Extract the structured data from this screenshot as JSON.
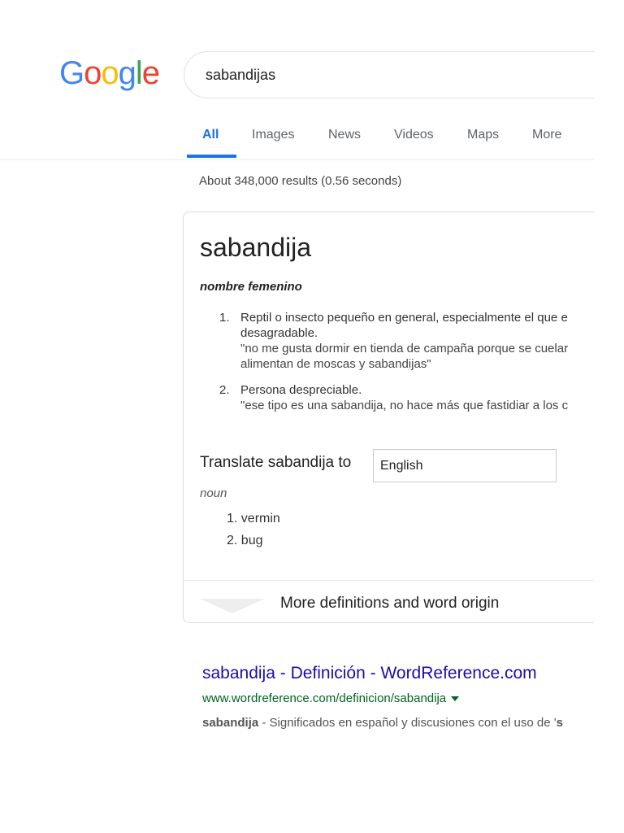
{
  "logo": {
    "text": "Google",
    "letters": [
      {
        "ch": "G",
        "color": "#4285F4"
      },
      {
        "ch": "o",
        "color": "#EA4335"
      },
      {
        "ch": "o",
        "color": "#FBBC05"
      },
      {
        "ch": "g",
        "color": "#4285F4"
      },
      {
        "ch": "l",
        "color": "#34A853"
      },
      {
        "ch": "e",
        "color": "#EA4335"
      }
    ]
  },
  "search": {
    "query": "sabandijas"
  },
  "tabs": [
    {
      "label": "All",
      "active": true
    },
    {
      "label": "Images"
    },
    {
      "label": "News"
    },
    {
      "label": "Videos"
    },
    {
      "label": "Maps"
    },
    {
      "label": "More"
    }
  ],
  "stats": "About 348,000 results (0.56 seconds)",
  "dictionary": {
    "word": "sabandija",
    "part_of_speech": "nombre femenino",
    "definitions": [
      {
        "num": "1.",
        "line1": "Reptil o insecto pequeño en general, especialmente el que e",
        "line2": "desagradable.",
        "ex1": "\"no me gusta dormir en tienda de campaña porque se cuelar",
        "ex2": "alimentan de moscas y sabandijas\""
      },
      {
        "num": "2.",
        "line1": "Persona despreciable.",
        "ex1": "\"ese tipo es una sabandija, no hace más que fastidiar a los c"
      }
    ],
    "translate_label": "Translate sabandija to",
    "translate_language": "English",
    "translate_pos": "noun",
    "translations": [
      "1. vermin",
      "2. bug"
    ],
    "more_link": "More definitions and word origin"
  },
  "result": {
    "title": "sabandija - Definición - WordReference.com",
    "url": "www.wordreference.com/definicion/sabandija",
    "snippet_bold": "sabandija",
    "snippet_rest": " - Significados en español y discusiones con el uso de '",
    "snippet_tail": "s"
  },
  "colors": {
    "link": "#1a0dab",
    "url": "#006621",
    "accent": "#1a73e8"
  }
}
